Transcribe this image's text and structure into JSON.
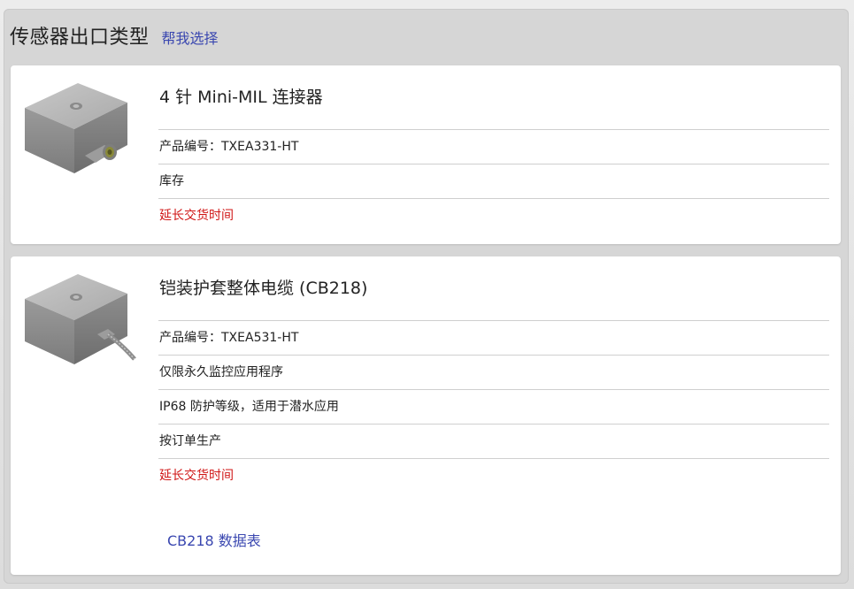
{
  "header": {
    "title": "传感器出口类型",
    "help_link": "帮我选择"
  },
  "products": [
    {
      "title": "4 针 Mini-MIL 连接器",
      "part_number": "产品编号：TXEA331-HT",
      "rows": [
        "库存"
      ],
      "lead_time": "延长交货时间",
      "image": "sensor-connector-icon"
    },
    {
      "title": "铠装护套整体电缆 (CB218)",
      "part_number": "产品编号：TXEA531-HT",
      "rows": [
        "仅限永久监控应用程序",
        "IP68 防护等级，适用于潜水应用",
        "按订单生产"
      ],
      "lead_time": "延长交货时间",
      "datasheet_link": "CB218 数据表",
      "image": "sensor-cable-icon"
    }
  ],
  "colors": {
    "link": "#3a47b0",
    "warning": "#d01515",
    "panel_bg": "#d6d6d6",
    "card_bg": "#ffffff"
  }
}
